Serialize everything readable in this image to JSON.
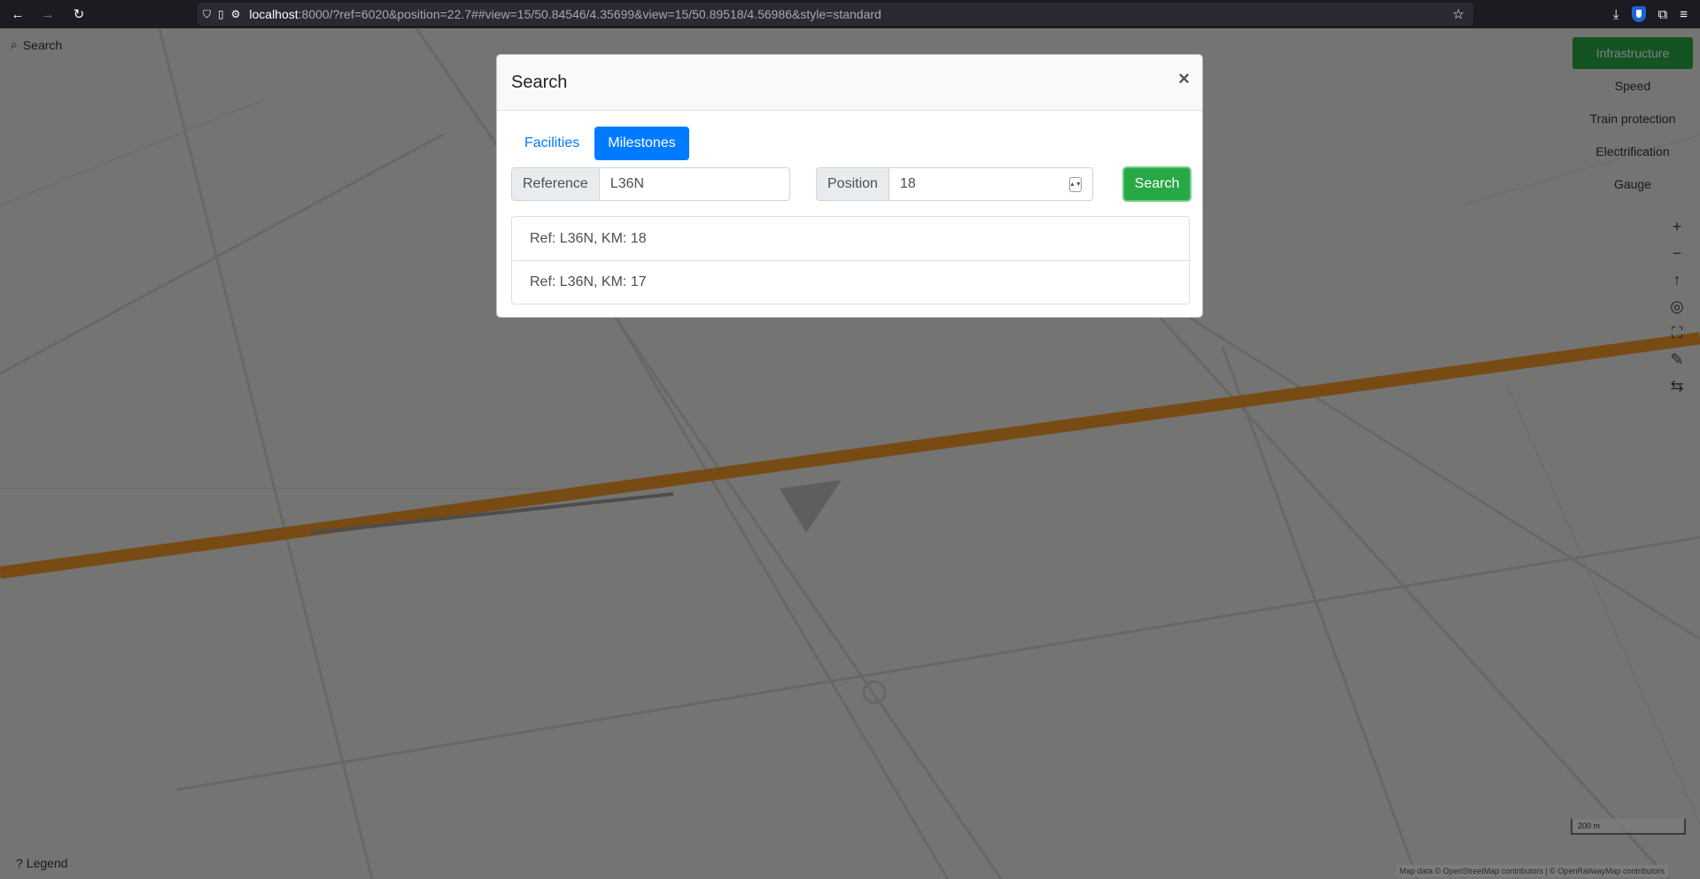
{
  "browser": {
    "url_host": "localhost",
    "url_rest": ":8000/?ref=6020&position=22.7##view=15/50.84546/4.35699&view=15/50.89518/4.56986&style=standard"
  },
  "map": {
    "search_label": "Search",
    "legend_label": "Legend",
    "layers": {
      "active": "Infrastructure",
      "items": [
        "Speed",
        "Train protection",
        "Electrification",
        "Gauge"
      ]
    },
    "scale_label": "200 m",
    "attribution": "Map data © OpenStreetMap contributors | © OpenRailwayMap contributors"
  },
  "modal": {
    "title": "Search",
    "close_label": "×",
    "tabs": [
      "Facilities",
      "Milestones"
    ],
    "active_tab": "Milestones",
    "reference_label": "Reference",
    "reference_value": "L36N",
    "position_label": "Position",
    "position_value": "18",
    "search_button": "Search",
    "results": [
      "Ref: L36N, KM: 18",
      "Ref: L36N, KM: 17"
    ]
  },
  "colors": {
    "railway": "#f0962a",
    "primary": "#007bff",
    "success": "#28a745"
  }
}
